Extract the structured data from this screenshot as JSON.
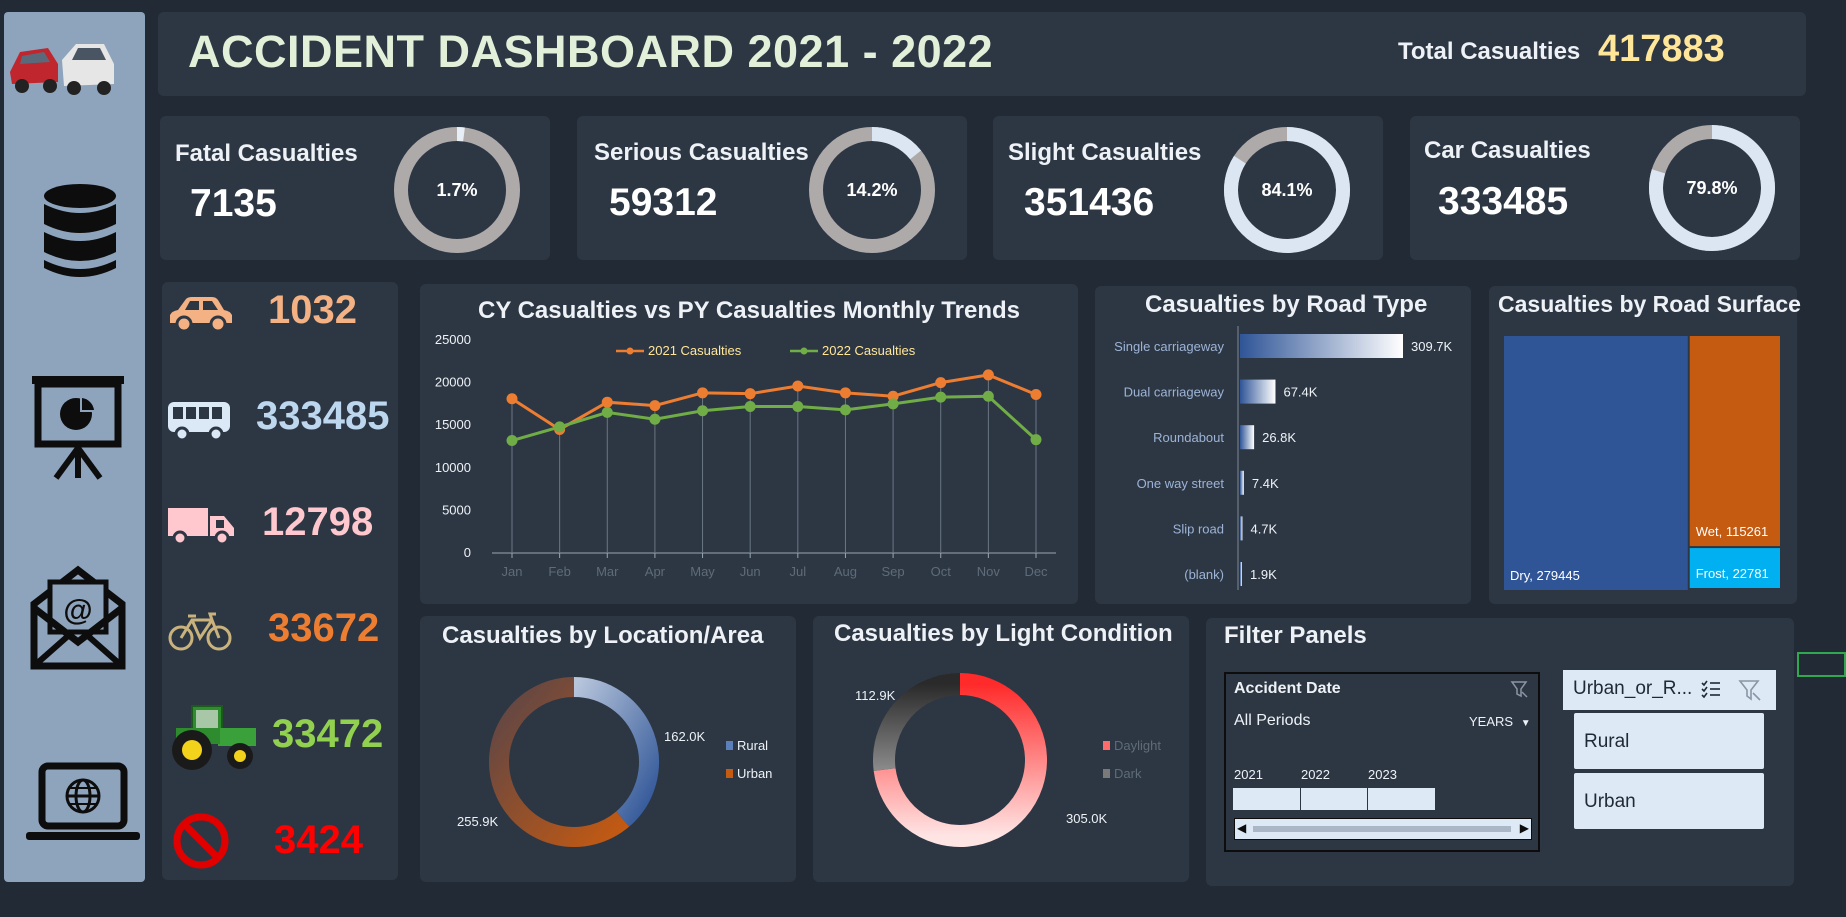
{
  "header": {
    "title": "ACCIDENT DASHBOARD 2021 - 2022",
    "total_label": "Total Casualties",
    "total_value": "417883"
  },
  "sidebar": {
    "icons": [
      "car-crash-icon",
      "database-icon",
      "presentation-icon",
      "email-icon",
      "laptop-globe-icon"
    ]
  },
  "kpis": [
    {
      "label": "Fatal Casualties",
      "value": "7135",
      "pct": "1.7%",
      "fraction": 0.017,
      "ring": "#aeaaaa",
      "fill": "#e8eef5"
    },
    {
      "label": "Serious Casualties",
      "value": "59312",
      "pct": "14.2%",
      "fraction": 0.142,
      "ring": "#aeaaaa",
      "fill": "#dbe6f2"
    },
    {
      "label": "Slight Casualties",
      "value": "351436",
      "pct": "84.1%",
      "fraction": 0.841,
      "ring": "#aeaaaa",
      "fill": "#dbe6f2"
    },
    {
      "label": "Car Casualties",
      "value": "333485",
      "pct": "79.8%",
      "fraction": 0.798,
      "ring": "#aeaaaa",
      "fill": "#dbe6f2"
    }
  ],
  "vehicles": [
    {
      "icon": "car-icon",
      "value": "1032",
      "color": "#f4b183"
    },
    {
      "icon": "bus-icon",
      "value": "333485",
      "color": "#bdd7ee"
    },
    {
      "icon": "truck-icon",
      "value": "12798",
      "color": "#ffc7ce"
    },
    {
      "icon": "bicycle-icon",
      "value": "33672",
      "color": "#ed7d31"
    },
    {
      "icon": "tractor-icon",
      "value": "33472",
      "color": "#92d050"
    },
    {
      "icon": "no-entry-icon",
      "value": "3424",
      "color": "#ff0000"
    }
  ],
  "chart_data": [
    {
      "type": "line",
      "title": "CY Casualties vs PY Casualties Monthly Trends",
      "categories": [
        "Jan",
        "Feb",
        "Mar",
        "Apr",
        "May",
        "Jun",
        "Jul",
        "Aug",
        "Sep",
        "Oct",
        "Nov",
        "Dec"
      ],
      "series": [
        {
          "name": "2021 Casualties",
          "color": "#ed7d31",
          "values": [
            18100,
            14500,
            17700,
            17300,
            18800,
            18700,
            19600,
            18800,
            18400,
            20000,
            20900,
            18600
          ]
        },
        {
          "name": "2022 Casualties",
          "color": "#70ad47",
          "values": [
            13200,
            14800,
            16500,
            15700,
            16700,
            17200,
            17200,
            16800,
            17500,
            18300,
            18400,
            13300
          ]
        }
      ],
      "yticks": [
        "0",
        "5000",
        "10000",
        "15000",
        "20000",
        "25000"
      ],
      "ylim": [
        0,
        25000
      ],
      "legend": "top"
    },
    {
      "type": "bar",
      "orientation": "horizontal",
      "title": "Casualties by Road Type",
      "categories": [
        "Single carriageway",
        "Dual carriageway",
        "Roundabout",
        "One way street",
        "Slip road",
        "(blank)"
      ],
      "values": [
        309700,
        67400,
        26800,
        7400,
        4700,
        1900
      ],
      "labels": [
        "309.7K",
        "67.4K",
        "26.8K",
        "7.4K",
        "4.7K",
        "1.9K"
      ]
    },
    {
      "type": "treemap",
      "title": "Casualties by Road Surface",
      "items": [
        {
          "label": "Dry, 279445",
          "name": "Dry",
          "value": 279445,
          "color": "#2f5597"
        },
        {
          "label": "Wet, 115261",
          "name": "Wet",
          "value": 115261,
          "color": "#c55a11"
        },
        {
          "label": "Frost, 22781",
          "name": "Frost",
          "value": 22781,
          "color": "#00b0f0"
        }
      ]
    },
    {
      "type": "pie",
      "title": "Casualties by Location/Area",
      "slices": [
        {
          "name": "Rural",
          "value": 162000,
          "label": "162.0K"
        },
        {
          "name": "Urban",
          "value": 255900,
          "label": "255.9K"
        }
      ],
      "legend": "right"
    },
    {
      "type": "pie",
      "title": "Casualties by Light Condition",
      "slices": [
        {
          "name": "Daylight",
          "value": 305000,
          "label": "305.0K"
        },
        {
          "name": "Dark",
          "value": 112900,
          "label": "112.9K"
        }
      ],
      "legend": "right"
    }
  ],
  "filters": {
    "title": "Filter Panels",
    "date_slicer": {
      "title": "Accident Date",
      "period": "All Periods",
      "unit": "YEARS",
      "years": [
        "2021",
        "2022",
        "2023"
      ]
    },
    "area_slicer": {
      "title": "Urban_or_R...",
      "options": [
        "Rural",
        "Urban"
      ]
    }
  }
}
